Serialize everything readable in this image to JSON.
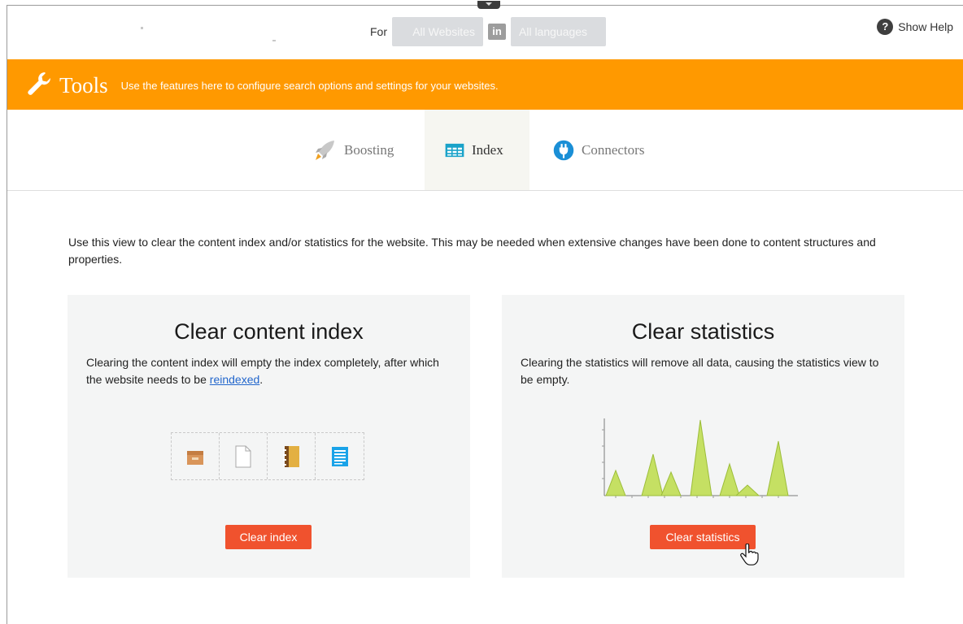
{
  "topbar": {
    "for_label": "For",
    "websites_pill": "All Websites",
    "in_badge": "in",
    "languages_pill": "All languages",
    "help_label": "Show Help",
    "help_icon": "question-icon"
  },
  "banner": {
    "title": "Tools",
    "description": "Use the features here to configure search options and settings for your websites.",
    "icon": "wrench-icon",
    "color": "#ff9900"
  },
  "tabs": [
    {
      "label": "Boosting",
      "icon": "rocket-icon",
      "active": false
    },
    {
      "label": "Index",
      "icon": "table-icon",
      "active": true
    },
    {
      "label": "Connectors",
      "icon": "plug-icon",
      "active": false
    }
  ],
  "intro": "Use this view to clear the content index and/or statistics for the website. This may be needed when extensive changes have been done to content structures and properties.",
  "cards": {
    "index": {
      "title": "Clear content index",
      "text_before": "Clearing the content index will empty the index completely, after which the website needs to be ",
      "link": "reindexed",
      "text_after": ".",
      "button": "Clear index"
    },
    "stats": {
      "title": "Clear statistics",
      "text": "Clearing the statistics will remove all data, causing the statistics view to be empty.",
      "button": "Clear statistics"
    }
  },
  "colors": {
    "accent_button": "#f0522e",
    "card_bg": "#f4f5f5",
    "link": "#2266cc",
    "chart_fill": "#c5e063"
  }
}
